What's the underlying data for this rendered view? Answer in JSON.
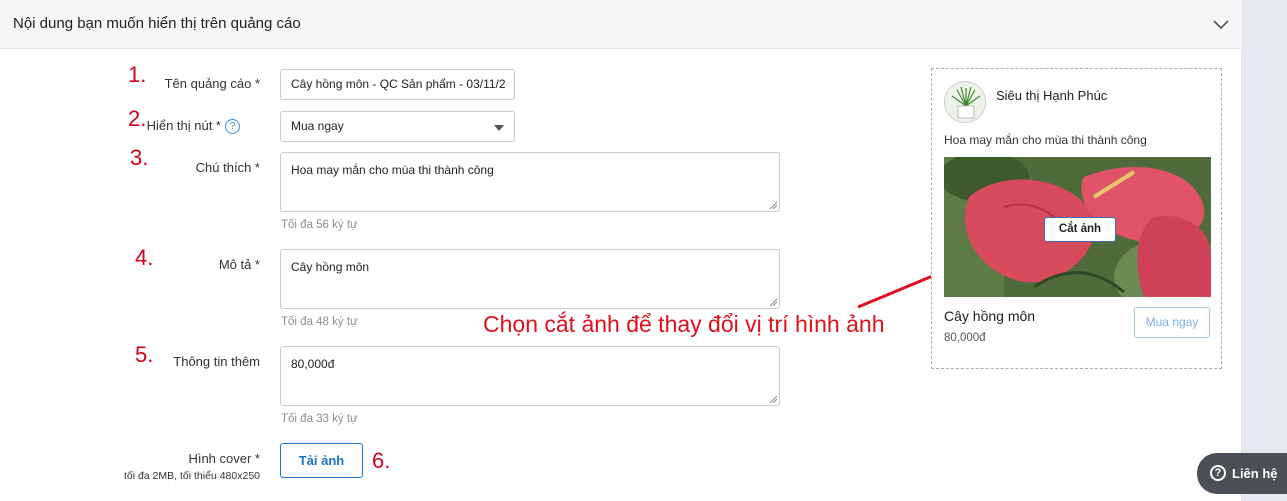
{
  "panel": {
    "title": "Nội dung bạn muốn hiển thị trên quảng cáo"
  },
  "numbers": [
    "1.",
    "2.",
    "3.",
    "4.",
    "5.",
    "6."
  ],
  "form": {
    "ad_name": {
      "label": "Tên quảng cáo *",
      "value": "Cây hồng môn - QC Sản phẩm - 03/11/2"
    },
    "button": {
      "label": "Hiển thị nút *",
      "help": "?",
      "selected": "Mua ngay"
    },
    "caption": {
      "label": "Chú thích *",
      "value": "Hoa may mắn cho mùa thi thành công",
      "hint": "Tối đa 56 ký tự"
    },
    "description": {
      "label": "Mô tả *",
      "value": "Cây hồng môn",
      "hint": "Tối đa 48 ký tự"
    },
    "extra": {
      "label": "Thông tin thêm",
      "value": "80,000đ",
      "hint": "Tối đa 33 ký tự"
    },
    "cover": {
      "label": "Hình cover *",
      "sublabel": "tối đa 2MB, tối thiểu 480x250",
      "button": "Tải ảnh"
    }
  },
  "annotation": "Chọn cắt ảnh để thay đổi vị trí hình ảnh",
  "preview": {
    "page_name": "Siêu thị Hạnh Phúc",
    "caption": "Hoa may mắn cho mùa thi thành công",
    "crop_button": "Cắt ảnh",
    "product_title": "Cây hồng môn",
    "product_price": "80,000đ",
    "cta": "Mua ngay"
  },
  "contact": {
    "label": "Liên hệ",
    "icon": "?"
  },
  "colors": {
    "annotation": "#e0101a",
    "accent": "#1a73c7"
  }
}
